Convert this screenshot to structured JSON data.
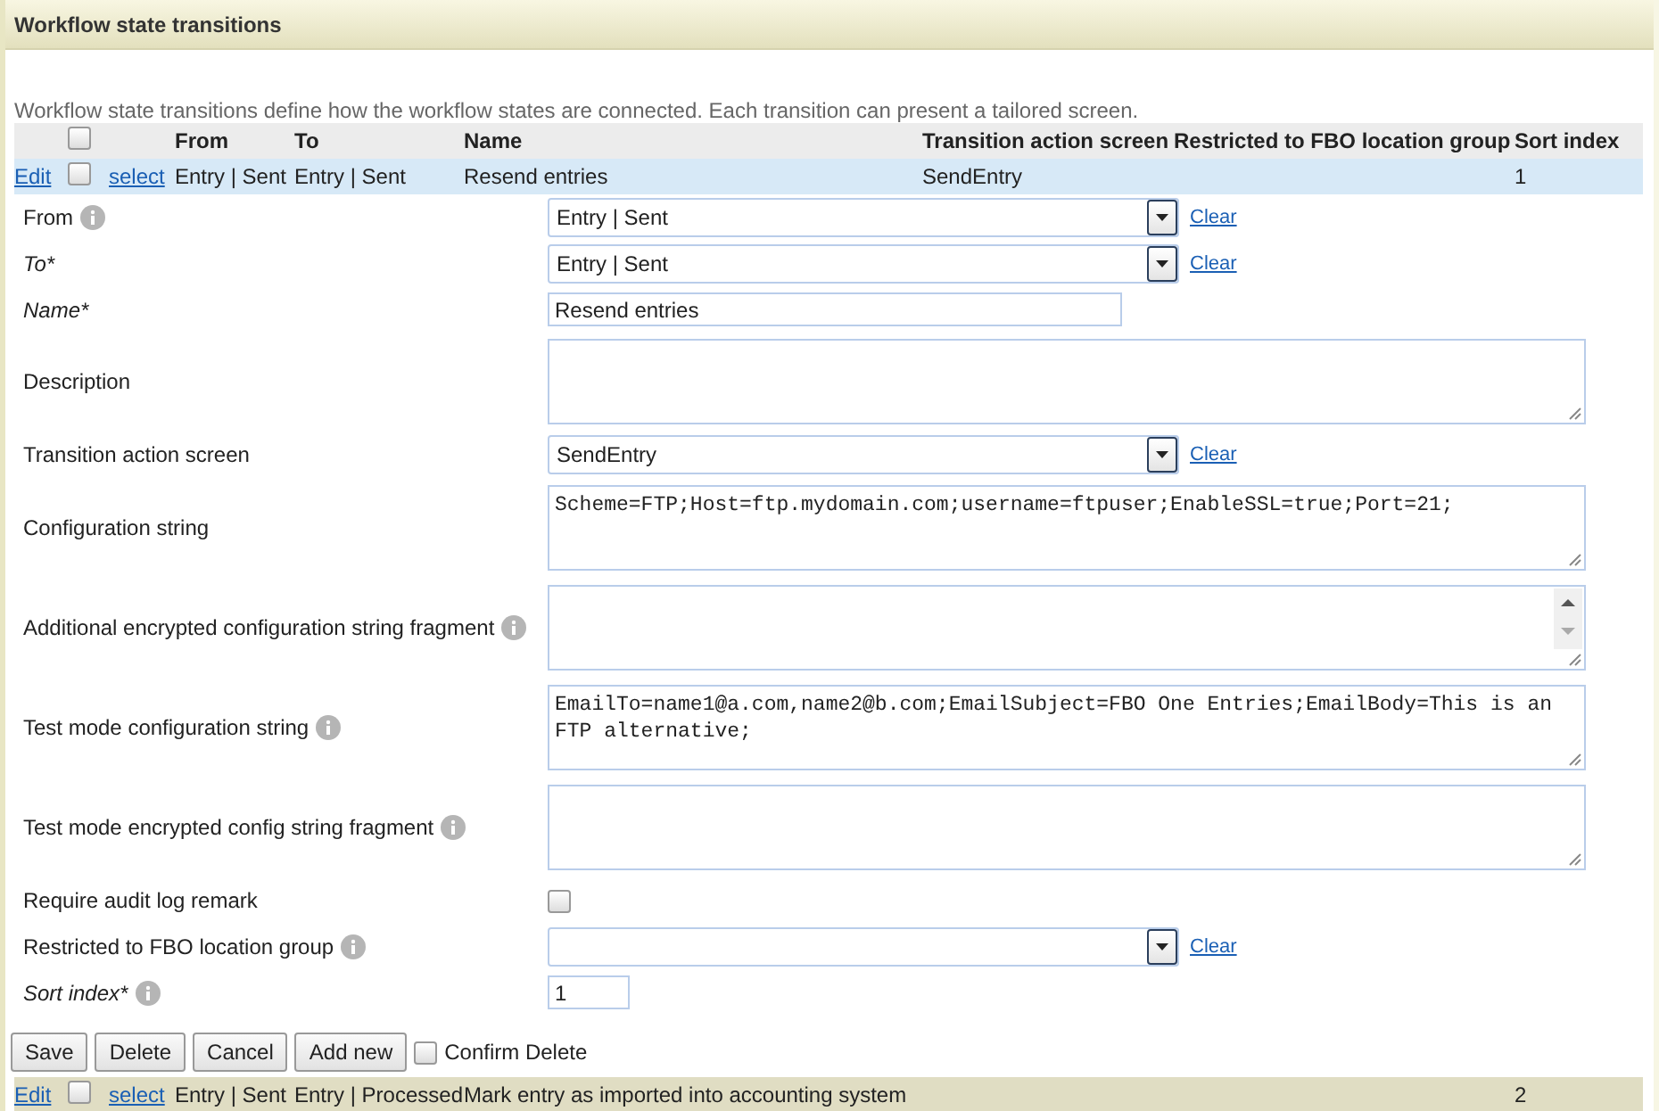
{
  "panel": {
    "title": "Workflow state transitions",
    "description": "Workflow state transitions define how the workflow states are connected. Each transition can present a tailored screen."
  },
  "table": {
    "columns": [
      "From",
      "To",
      "Name",
      "Transition action screen",
      "Restricted to FBO location group",
      "Sort index"
    ],
    "header_checked": false,
    "rows": [
      {
        "edit": "Edit",
        "select": "select",
        "checked": false,
        "selected": true,
        "cells": [
          "Entry | Sent",
          "Entry | Sent",
          "Resend entries",
          "SendEntry",
          "",
          "1"
        ]
      }
    ],
    "rows_after": [
      {
        "edit": "Edit",
        "select": "select",
        "checked": false,
        "selected": false,
        "cells": [
          "Entry | Sent",
          "Entry | Processed",
          "Mark entry as imported into accounting system",
          "",
          "",
          "2"
        ]
      }
    ]
  },
  "form": {
    "fields": [
      {
        "label": "From",
        "required": false,
        "info": true,
        "kind": "select",
        "value": "Entry | Sent",
        "clear": "Clear"
      },
      {
        "label": "To*",
        "required": true,
        "info": false,
        "kind": "select",
        "value": "Entry | Sent",
        "clear": "Clear"
      },
      {
        "label": "Name*",
        "required": true,
        "info": false,
        "kind": "text",
        "value": "Resend entries"
      },
      {
        "label": "Description",
        "required": false,
        "info": false,
        "kind": "textarea"
      },
      {
        "label": "Transition action screen",
        "required": false,
        "info": false,
        "kind": "select",
        "value": "SendEntry",
        "clear": "Clear"
      },
      {
        "label": "Configuration string",
        "required": false,
        "info": false,
        "kind": "textarea",
        "value": "Scheme=FTP;Host=ftp.mydomain.com;username=ftpuser;EnableSSL=true;Port=21;"
      },
      {
        "label": "Additional encrypted configuration string fragment",
        "required": false,
        "info": true,
        "kind": "textarea_scroll"
      },
      {
        "label": "Test mode configuration string",
        "required": false,
        "info": true,
        "kind": "textarea",
        "value": "EmailTo=name1@a.com,name2@b.com;EmailSubject=FBO One Entries;EmailBody=This is an FTP alternative;"
      },
      {
        "label": "Test mode encrypted config string fragment",
        "required": false,
        "info": true,
        "kind": "textarea"
      },
      {
        "label": "Require audit log remark",
        "required": false,
        "info": false,
        "kind": "checkbox",
        "checked": false
      },
      {
        "label": "Restricted to FBO location group",
        "required": false,
        "info": true,
        "kind": "select",
        "clear": "Clear"
      },
      {
        "label": "Sort index*",
        "required": true,
        "info": true,
        "kind": "number",
        "value": "1"
      }
    ],
    "buttons": [
      "Save",
      "Delete",
      "Cancel",
      "Add new"
    ],
    "confirm": {
      "label": "Confirm Delete",
      "checked": false
    }
  }
}
